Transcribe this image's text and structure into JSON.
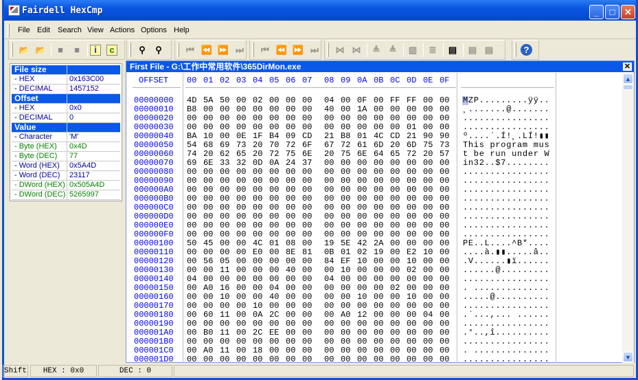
{
  "window": {
    "title": "Fairdell HexCmp",
    "minimize": "_",
    "maximize": "□",
    "close": "✕"
  },
  "menu": [
    "File",
    "Edit",
    "Search",
    "View",
    "Actions",
    "Options",
    "Help"
  ],
  "toolbar": {
    "icons": [
      "open-file-1-icon",
      "open-file-2-icon",
      "stop-icon",
      "close-icon",
      "info-icon",
      "compare-icon",
      "find-icon",
      "find-next-icon",
      "first-diff-icon",
      "prev-diff-icon",
      "next-diff-icon",
      "last-diff-icon",
      "first-block-icon",
      "prev-block-icon",
      "next-block-icon",
      "last-block-icon",
      "merge-left-icon",
      "merge-right-icon",
      "align-up-icon",
      "align-down-icon",
      "columns-icon",
      "rows-icon",
      "new-report-icon",
      "copy-left-icon",
      "copy-right-icon",
      "help-icon"
    ],
    "labels": {
      "info": "i",
      "compare": "c",
      "help": "?"
    }
  },
  "panel": {
    "file_size": {
      "label": "File size",
      "hex_label": "- HEX",
      "hex": "0x163C00",
      "dec_label": "- DECIMAL",
      "dec": "1457152"
    },
    "offset": {
      "label": "Offset",
      "hex_label": "- HEX",
      "hex": "0x0",
      "dec_label": "- DECIMAL",
      "dec": "0"
    },
    "value": {
      "label": "Value",
      "items": [
        {
          "k": "- Character",
          "v": "'M'",
          "c": "b"
        },
        {
          "k": "- Byte (HEX)",
          "v": "0x4D",
          "c": "g"
        },
        {
          "k": "- Byte (DEC)",
          "v": "77",
          "c": "g"
        },
        {
          "k": "- Word (HEX)",
          "v": "0x5A4D",
          "c": "b"
        },
        {
          "k": "- Word (DEC)",
          "v": "23117",
          "c": "b"
        },
        {
          "k": "- DWord (HEX)",
          "v": "0x505A4D",
          "c": "g"
        },
        {
          "k": "- DWord (DEC)",
          "v": "5265997",
          "c": "g"
        }
      ]
    }
  },
  "child": {
    "title": "First File - G:\\工作中常用软件\\365DirMon.exe",
    "close": "✕",
    "offset_header": "OFFSET",
    "columns": [
      "00",
      "01",
      "02",
      "03",
      "04",
      "05",
      "06",
      "07",
      "08",
      "09",
      "0A",
      "0B",
      "0C",
      "0D",
      "0E",
      "0F"
    ],
    "rows": [
      {
        "o": "00000000",
        "b": "4D 5A 50 00 02 00 00 00 04 00 0F 00 FF FF 00 00",
        "a": "MZP.........ÿÿ.."
      },
      {
        "o": "00000010",
        "b": "B8 00 00 00 00 00 00 00 40 00 1A 00 00 00 00 00",
        "a": "¸.......@......."
      },
      {
        "o": "00000020",
        "b": "00 00 00 00 00 00 00 00 00 00 00 00 00 00 00 00",
        "a": "................"
      },
      {
        "o": "00000030",
        "b": "00 00 00 00 00 00 00 00 00 00 00 00 00 01 00 00",
        "a": "................"
      },
      {
        "o": "00000040",
        "b": "BA 10 00 0E 1F B4 09 CD 21 B8 01 4C CD 21 90 90",
        "a": "º....´.Í!¸.LÍ!▮▮"
      },
      {
        "o": "00000050",
        "b": "54 68 69 73 20 70 72 6F 67 72 61 6D 20 6D 75 73",
        "a": "This program mus"
      },
      {
        "o": "00000060",
        "b": "74 20 62 65 20 72 75 6E 20 75 6E 64 65 72 20 57",
        "a": "t be run under W"
      },
      {
        "o": "00000070",
        "b": "69 6E 33 32 0D 0A 24 37 00 00 00 00 00 00 00 00",
        "a": "in32..$7........"
      },
      {
        "o": "00000080",
        "b": "00 00 00 00 00 00 00 00 00 00 00 00 00 00 00 00",
        "a": "................"
      },
      {
        "o": "00000090",
        "b": "00 00 00 00 00 00 00 00 00 00 00 00 00 00 00 00",
        "a": "................"
      },
      {
        "o": "000000A0",
        "b": "00 00 00 00 00 00 00 00 00 00 00 00 00 00 00 00",
        "a": "................"
      },
      {
        "o": "000000B0",
        "b": "00 00 00 00 00 00 00 00 00 00 00 00 00 00 00 00",
        "a": "................"
      },
      {
        "o": "000000C0",
        "b": "00 00 00 00 00 00 00 00 00 00 00 00 00 00 00 00",
        "a": "................"
      },
      {
        "o": "000000D0",
        "b": "00 00 00 00 00 00 00 00 00 00 00 00 00 00 00 00",
        "a": "................"
      },
      {
        "o": "000000E0",
        "b": "00 00 00 00 00 00 00 00 00 00 00 00 00 00 00 00",
        "a": "................"
      },
      {
        "o": "000000F0",
        "b": "00 00 00 00 00 00 00 00 00 00 00 00 00 00 00 00",
        "a": "................"
      },
      {
        "o": "00000100",
        "b": "50 45 00 00 4C 01 08 00 19 5E 42 2A 00 00 00 00",
        "a": "PE..L....^B*...."
      },
      {
        "o": "00000110",
        "b": "00 00 00 00 E0 00 8E 81 0B 01 02 19 00 E2 10 00",
        "a": "....à.▮▮.....â.."
      },
      {
        "o": "00000120",
        "b": "00 56 05 00 00 00 00 00 84 EF 10 00 00 10 00 00",
        "a": ".V......▮ï......"
      },
      {
        "o": "00000130",
        "b": "00 00 11 00 00 00 40 00 00 10 00 00 00 02 00 00",
        "a": "......@........."
      },
      {
        "o": "00000140",
        "b": "04 00 00 00 00 00 00 00 04 00 00 00 00 00 00 00",
        "a": "................"
      },
      {
        "o": "00000150",
        "b": "00 A0 16 00 00 04 00 00 00 00 00 00 02 00 00 00",
        "a": ". .............."
      },
      {
        "o": "00000160",
        "b": "00 00 10 00 00 40 00 00 00 00 10 00 00 10 00 00",
        "a": ".....@.........."
      },
      {
        "o": "00000170",
        "b": "00 00 00 00 10 00 00 00 00 00 00 00 00 00 00 00",
        "a": "................"
      },
      {
        "o": "00000180",
        "b": "00 60 11 00 0A 2C 00 00 00 A0 12 00 00 00 04 00",
        "a": ".`...,... ......"
      },
      {
        "o": "00000190",
        "b": "00 00 00 00 00 00 00 00 00 00 00 00 00 00 00 00",
        "a": "................"
      },
      {
        "o": "000001A0",
        "b": "00 B0 11 00 2C EE 00 00 00 00 00 00 00 00 00 00",
        "a": ".°..,î.........."
      },
      {
        "o": "000001B0",
        "b": "00 00 00 00 00 00 00 00 00 00 00 00 00 00 00 00",
        "a": "................"
      },
      {
        "o": "000001C0",
        "b": "00 A0 11 00 18 00 00 00 00 00 00 00 00 00 00 00",
        "a": ". .............."
      },
      {
        "o": "000001D0",
        "b": "00 00 00 00 00 00 00 00 00 00 00 00 00 00 00 00",
        "a": "................"
      }
    ]
  },
  "status": {
    "shift": "Shift",
    "hex": "HEX : 0x0",
    "dec": "DEC : 0"
  }
}
